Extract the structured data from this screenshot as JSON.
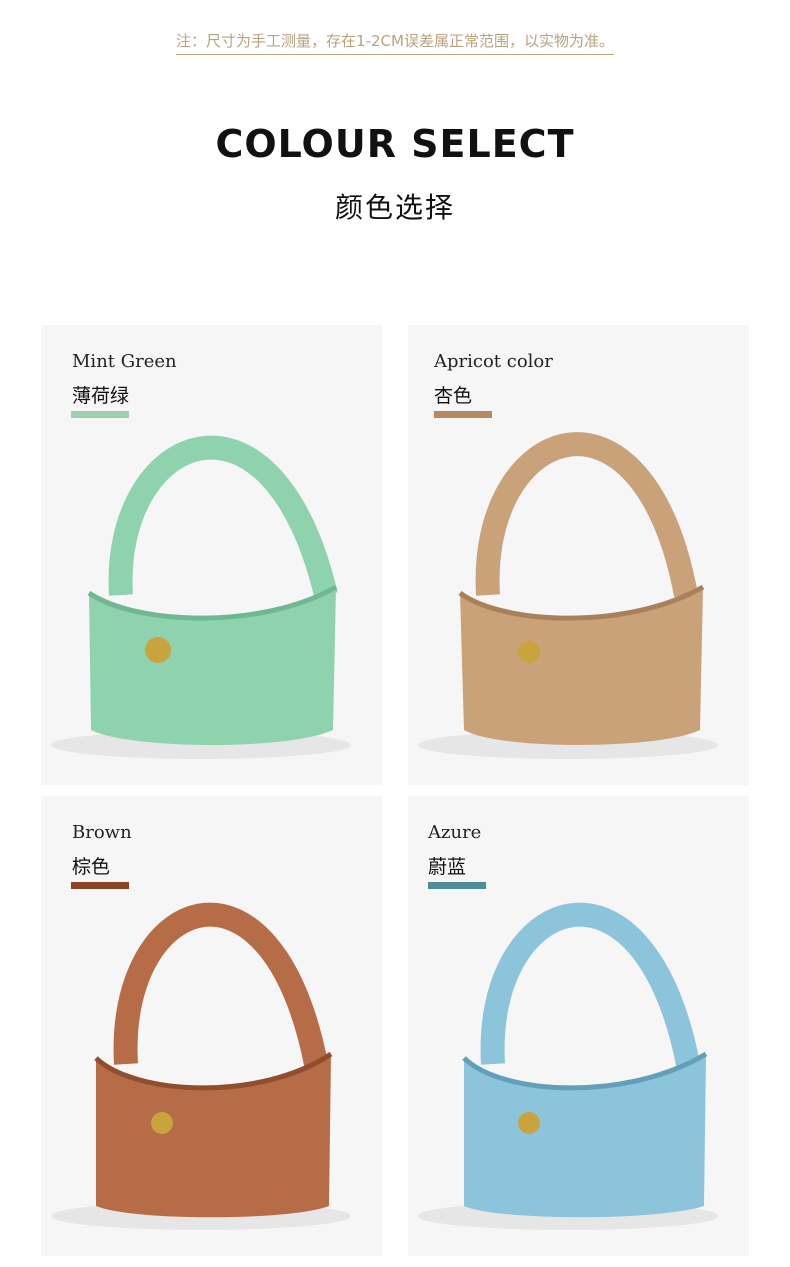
{
  "note": "注：尺寸为手工测量，存在1-2CM误差属正常范围，以实物为准。",
  "title_en": "COLOUR SELECT",
  "title_cn": "颜色选择",
  "colors": [
    {
      "name_en": "Mint Green",
      "name_cn": "薄荷绿",
      "swatch": "#9fcfb1",
      "bag": "#8fd3ae",
      "shade": "#6fb891"
    },
    {
      "name_en": "Apricot color",
      "name_cn": "杏色",
      "swatch": "#b48a62",
      "bag": "#c9a27a",
      "shade": "#a8815b"
    },
    {
      "name_en": "Brown",
      "name_cn": "棕色",
      "swatch": "#8a4527",
      "bag": "#b66d47",
      "shade": "#8f4f2f"
    },
    {
      "name_en": "Azure",
      "name_cn": "蔚蓝",
      "swatch": "#4f8a97",
      "bag": "#8cc4dc",
      "shade": "#62a0ba"
    }
  ]
}
